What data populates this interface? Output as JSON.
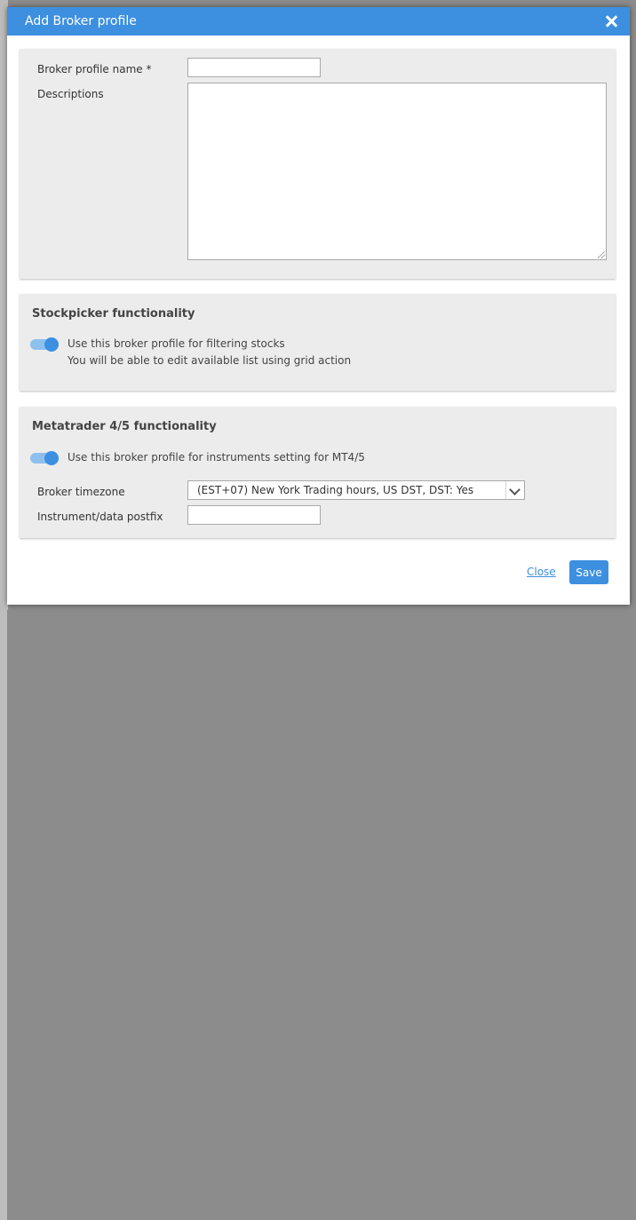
{
  "dialog": {
    "title": "Add Broker profile",
    "close_icon": "close-icon"
  },
  "general": {
    "name_label": "Broker profile name *",
    "name_value": "",
    "description_label": "Descriptions",
    "description_value": ""
  },
  "stockpicker": {
    "title": "Stockpicker functionality",
    "toggle_on": true,
    "toggle_text": "Use this broker profile for filtering stocks",
    "hint_text": "You will be able to edit available list using grid action"
  },
  "metatrader": {
    "title": "Metatrader 4/5 functionality",
    "toggle_on": true,
    "toggle_text": "Use this broker profile for instruments setting for MT4/5",
    "timezone_label": "Broker timezone",
    "timezone_value": "(EST+07) New York Trading hours, US DST, DST: Yes",
    "postfix_label": "Instrument/data postfix",
    "postfix_value": ""
  },
  "footer": {
    "close_label": "Close",
    "save_label": "Save"
  },
  "colors": {
    "accent": "#3d8fe0",
    "panel_bg": "#ececec"
  }
}
